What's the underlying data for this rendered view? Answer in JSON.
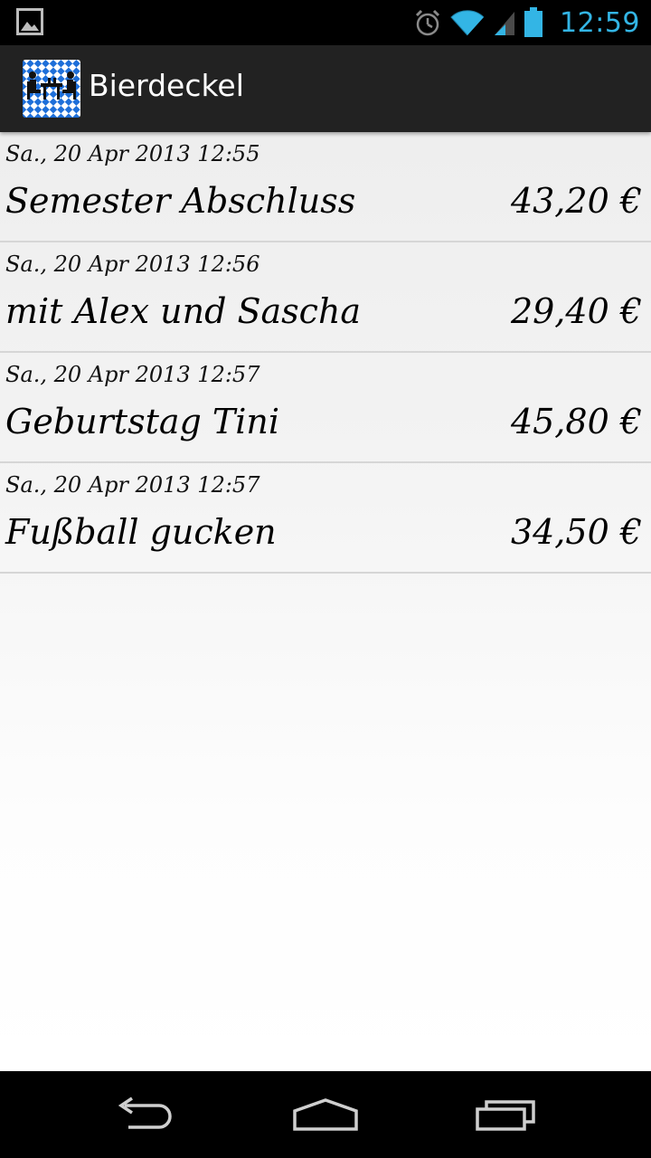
{
  "status_bar": {
    "time": "12:59",
    "icons": [
      "gallery-notification-icon",
      "alarm-icon",
      "wifi-icon",
      "signal-icon",
      "battery-icon"
    ]
  },
  "action_bar": {
    "title": "Bierdeckel",
    "icon": "bavarian-table-logo"
  },
  "entries": [
    {
      "date": "Sa., 20 Apr 2013 12:55",
      "name": "Semester Abschluss",
      "amount": "43,20 €"
    },
    {
      "date": "Sa., 20 Apr 2013 12:56",
      "name": "mit Alex und Sascha",
      "amount": "29,40 €"
    },
    {
      "date": "Sa., 20 Apr 2013 12:57",
      "name": "Geburtstag Tini",
      "amount": "45,80 €"
    },
    {
      "date": "Sa., 20 Apr 2013 12:57",
      "name": "Fußball gucken",
      "amount": "34,50 €"
    }
  ],
  "nav_bar": {
    "buttons": [
      "back-icon",
      "home-icon",
      "recent-apps-icon"
    ]
  },
  "colors": {
    "accent_time": "#33b5e5",
    "action_bar_bg": "#222222",
    "logo_blue": "#1e6fd9"
  }
}
